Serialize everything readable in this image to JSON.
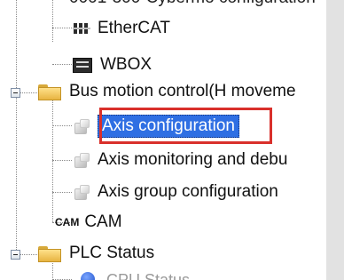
{
  "tree": {
    "cut_top_text": "0001-300-Cybermo configuration",
    "items": [
      {
        "label": "EtherCAT",
        "icon": "ethercat-icon"
      },
      {
        "label": "WBOX",
        "icon": "wbox-icon"
      },
      {
        "label": "Bus motion control(H moveme",
        "icon": "folder-icon",
        "expanded": true
      },
      {
        "label": "Axis configuration",
        "icon": "cube-icon",
        "selected": true
      },
      {
        "label": "Axis monitoring and debu",
        "icon": "cube-icon"
      },
      {
        "label": "Axis group configuration",
        "icon": "cube-icon"
      },
      {
        "label": "CAM",
        "icon_text": "CAM"
      },
      {
        "label": "PLC Status",
        "icon": "folder-icon",
        "expanded": true
      }
    ],
    "cut_bottom_text": "CPU Status"
  },
  "colors": {
    "selection": "#2f6fe3",
    "highlight_border": "#d9302b",
    "folder": "#e7b441"
  }
}
